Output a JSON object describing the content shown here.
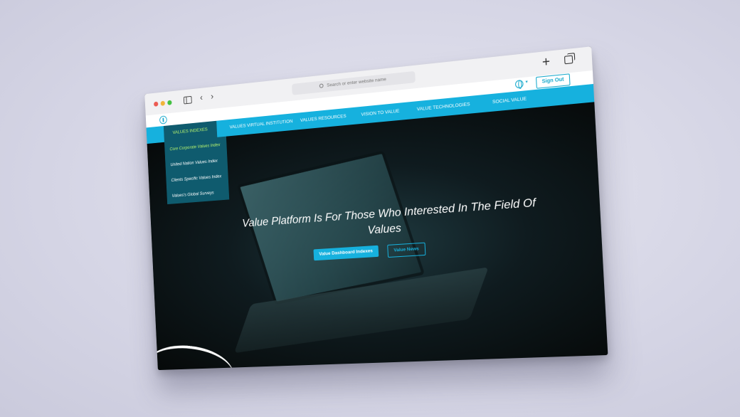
{
  "browser": {
    "address_placeholder": "Search or enter website name",
    "icons": [
      "sidebar-icon",
      "chevron-left-icon",
      "chevron-right-icon",
      "plus-icon",
      "tabs-icon",
      "search-icon"
    ]
  },
  "header": {
    "sign_out_label": "Sign Out",
    "icons": [
      "logo-icon",
      "globe-icon",
      "caret-down-icon"
    ]
  },
  "nav": {
    "items": [
      {
        "label": "VALUES INDEXES"
      },
      {
        "label": "VALUES VIRTUAL INSTITUTION"
      },
      {
        "label": "VALUES RESOURCES"
      },
      {
        "label": "VISION TO VALUE"
      },
      {
        "label": "VALUE TECHNOLOGIES"
      },
      {
        "label": "SOCIAL VALUE"
      }
    ],
    "active_index": 0
  },
  "dropdown": {
    "items": [
      {
        "label": "Core Corporate Values Index"
      },
      {
        "label": "United Nation Values Index"
      },
      {
        "label": "Clients Specific Values Index"
      },
      {
        "label": "Values's Global Surveys"
      }
    ]
  },
  "hero": {
    "title": "Value Platform Is For Those Who Interested In The Field Of Values",
    "primary_button": "Value Dashboard Indexes",
    "secondary_button": "Value News"
  },
  "colors": {
    "accent": "#16b1de",
    "nav_active": "#0f5b6e",
    "active_text": "#b7f46d"
  }
}
